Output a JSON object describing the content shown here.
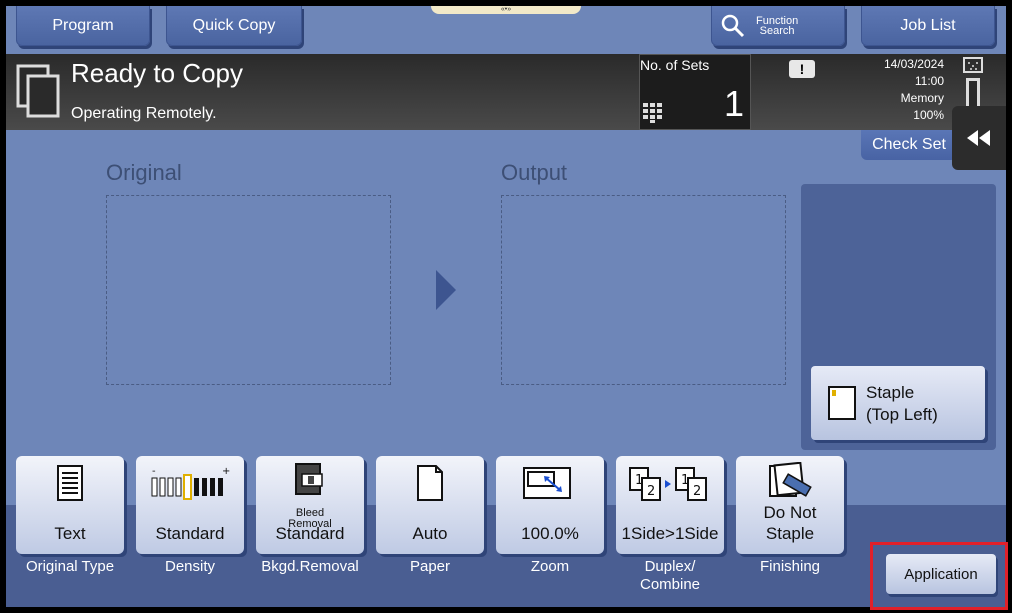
{
  "top_tabs": {
    "program": "Program",
    "quick_copy": "Quick Copy",
    "function_search_line1": "Function",
    "function_search_line2": "Search",
    "job_list": "Job List",
    "handle": "«•»"
  },
  "status": {
    "title": "Ready to Copy",
    "message": "Operating Remotely.",
    "sets_label": "No. of Sets",
    "sets_value": "1",
    "date": "14/03/2024",
    "time": "11:00",
    "memory_label": "Memory",
    "memory_value": "100%",
    "warning_glyph": "!"
  },
  "check_set": "Check Set",
  "preview": {
    "original_label": "Original",
    "output_label": "Output"
  },
  "finishing_panel": {
    "staple_line1": "Staple",
    "staple_line2": "(Top Left)"
  },
  "functions": {
    "original_type": {
      "value": "Text",
      "caption": "Original Type",
      "icon": "text-document-icon"
    },
    "density": {
      "value": "Standard",
      "caption": "Density",
      "icon": "density-scale-icon"
    },
    "bkgd_removal": {
      "value_line1": "Bleed",
      "value_line2": "Removal",
      "value_line3": "Standard",
      "caption": "Bkgd.Removal",
      "icon": "background-removal-icon"
    },
    "paper": {
      "value": "Auto",
      "caption": "Paper",
      "icon": "paper-icon"
    },
    "zoom": {
      "value": "100.0%",
      "caption": "Zoom",
      "icon": "zoom-icon"
    },
    "duplex": {
      "value": "1Side>1Side",
      "caption_line1": "Duplex/",
      "caption_line2": "Combine",
      "icon": "duplex-icon"
    },
    "finishing": {
      "value_line1": "Do Not",
      "value_line2": "Staple",
      "caption": "Finishing",
      "icon": "staple-finish-icon"
    }
  },
  "application": "Application",
  "colors": {
    "background": "#6e86b8",
    "status_bar": "#2a2a2a",
    "highlight": "#e0202a"
  }
}
